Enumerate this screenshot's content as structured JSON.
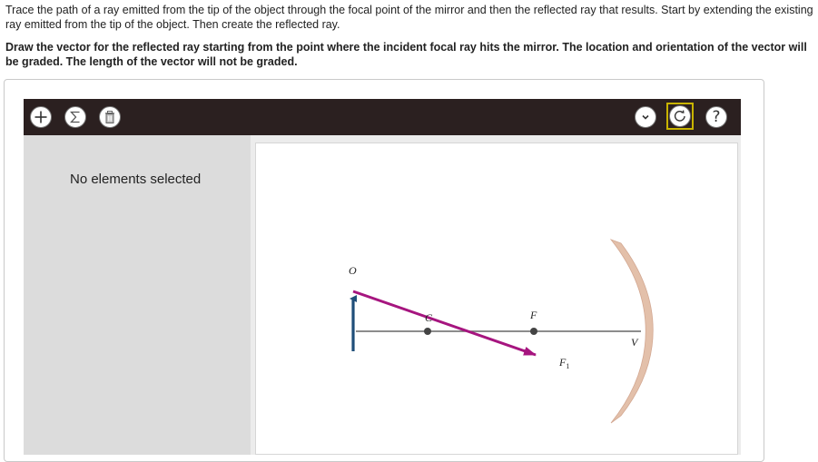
{
  "question": {
    "instruction": "Trace the path of a ray emitted from the tip of the object through the focal point of the mirror and then the reflected ray that results. Start by extending the existing ray emitted from the tip of the object. Then create the reflected ray.",
    "task": "Draw the vector for the reflected ray starting from the point where the incident focal ray hits the mirror. The location and orientation of the vector will be graded. The length of the vector will not be graded."
  },
  "toolbar": {
    "add_icon": "plus-icon",
    "sum_icon": "sigma-icon",
    "delete_icon": "trash-icon",
    "dropdown_icon": "chevron-down-icon",
    "reset_icon": "reset-icon",
    "help_label": "?"
  },
  "side_panel": {
    "empty_text": "No elements selected"
  },
  "diagram": {
    "object_label": "O",
    "center_label": "C",
    "focal_label": "F",
    "vertex_label": "V",
    "vector_label_base": "F",
    "vector_label_sub": "1",
    "colors": {
      "object_arrow": "#1f4e79",
      "ray": "#a6157f",
      "mirror": "#e3c0aa",
      "axis": "#666666"
    }
  }
}
